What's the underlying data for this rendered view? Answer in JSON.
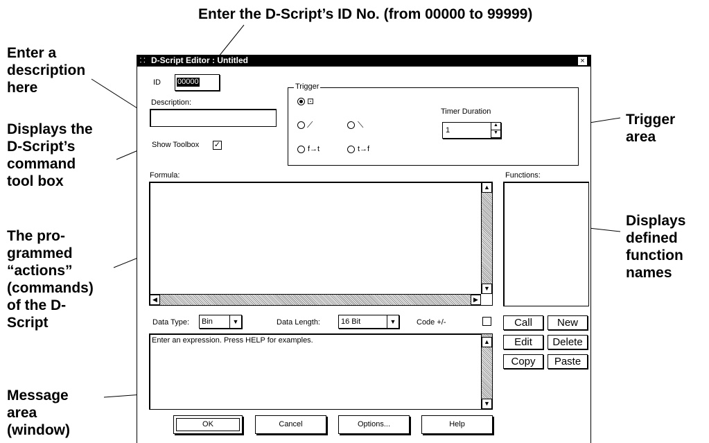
{
  "annotations": {
    "id_note": "Enter the D-Script’s ID No. (from 00000 to 99999)",
    "description_note": "Enter a\ndescription\nhere",
    "toolbox_note": "Displays the\nD-Script’s\ncommand\ntool box",
    "formula_note": "The pro-\ngrammed\n“actions”\n(commands)\nof the D-\nScript",
    "message_note": "Message\narea\n(window)",
    "trigger_note": "Trigger\narea",
    "functions_note": "Displays\ndefined\nfunction\nnames"
  },
  "dialog": {
    "title": "D-Script Editor : Untitled",
    "close_glyph": "×",
    "id_label": "ID",
    "id_value": "00000",
    "description_label": "Description:",
    "description_value": "",
    "show_toolbox_label": "Show Toolbox",
    "show_toolbox_checked": true,
    "trigger": {
      "legend": "Trigger",
      "timer_duration_label": "Timer Duration",
      "timer_duration_value": "1",
      "options": [
        {
          "icon": "⊡",
          "selected": true
        },
        {
          "icon": "⟋",
          "selected": false
        },
        {
          "icon": "⟍",
          "selected": false
        },
        {
          "icon": "f→t",
          "selected": false
        },
        {
          "icon": "t→f",
          "selected": false
        }
      ]
    },
    "formula_label": "Formula:",
    "functions_label": "Functions:",
    "data_type_label": "Data Type:",
    "data_type_value": "Bin",
    "data_length_label": "Data Length:",
    "data_length_value": "16 Bit",
    "code_label": "Code +/-",
    "message_text": "Enter an expression. Press HELP for examples.",
    "side_buttons": [
      "Call",
      "New",
      "Edit",
      "Delete",
      "Copy",
      "Paste"
    ],
    "bottom_buttons": [
      "OK",
      "Cancel",
      "Options...",
      "Help"
    ]
  },
  "colors": {
    "titlebar": "#000000",
    "background": "#ffffff"
  }
}
